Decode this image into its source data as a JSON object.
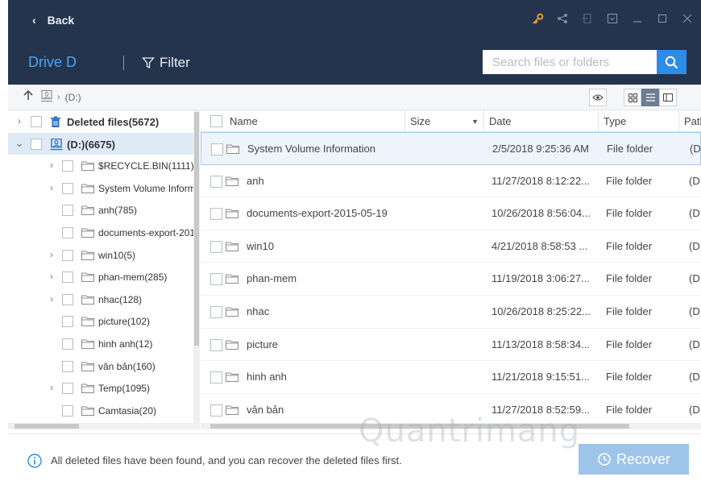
{
  "topbar": {
    "back_label": "Back",
    "drive_label": "Drive D",
    "filter_label": "Filter",
    "search_placeholder": "Search files or folders",
    "accent_color": "#2b8de8",
    "bar_color": "#24344d"
  },
  "pathbar": {
    "location": "(D:)"
  },
  "tree": {
    "items": [
      {
        "label": "Deleted files(5672)",
        "arrow": "›",
        "level": 0,
        "icon": "trash-icon"
      },
      {
        "label": "(D:)(6675)",
        "arrow": "⌄",
        "level": 0,
        "icon": "drive-icon",
        "selected": true
      },
      {
        "label": "$RECYCLE.BIN(1111)",
        "arrow": "›",
        "level": 1,
        "icon": "folder-icon"
      },
      {
        "label": "System Volume Inform",
        "arrow": "›",
        "level": 1,
        "icon": "folder-icon"
      },
      {
        "label": "anh(785)",
        "arrow": "",
        "level": 1,
        "icon": "folder-icon"
      },
      {
        "label": "documents-export-201",
        "arrow": "",
        "level": 1,
        "icon": "folder-icon"
      },
      {
        "label": "win10(5)",
        "arrow": "›",
        "level": 1,
        "icon": "folder-icon"
      },
      {
        "label": "phan-mem(285)",
        "arrow": "›",
        "level": 1,
        "icon": "folder-icon"
      },
      {
        "label": "nhac(128)",
        "arrow": "›",
        "level": 1,
        "icon": "folder-icon"
      },
      {
        "label": "picture(102)",
        "arrow": "",
        "level": 1,
        "icon": "folder-icon"
      },
      {
        "label": "hinh anh(12)",
        "arrow": "",
        "level": 1,
        "icon": "folder-icon"
      },
      {
        "label": "văn bản(160)",
        "arrow": "",
        "level": 1,
        "icon": "folder-icon"
      },
      {
        "label": "Temp(1095)",
        "arrow": "›",
        "level": 1,
        "icon": "folder-icon"
      },
      {
        "label": "Camtasia(20)",
        "arrow": "",
        "level": 1,
        "icon": "folder-icon"
      }
    ]
  },
  "list": {
    "columns": {
      "name": "Name",
      "size": "Size",
      "date": "Date",
      "type": "Type",
      "path": "Path"
    },
    "rows": [
      {
        "name": "System Volume Information",
        "date": "2/5/2018 9:25:36 AM",
        "type": "File folder",
        "path": "(D:",
        "selected": true
      },
      {
        "name": "anh",
        "date": "11/27/2018 8:12:22...",
        "type": "File folder",
        "path": "(D:"
      },
      {
        "name": "documents-export-2015-05-19",
        "date": "10/26/2018 8:56:04...",
        "type": "File folder",
        "path": "(D:"
      },
      {
        "name": "win10",
        "date": "4/21/2018 8:58:53 ...",
        "type": "File folder",
        "path": "(D:"
      },
      {
        "name": "phan-mem",
        "date": "11/19/2018 3:06:27...",
        "type": "File folder",
        "path": "(D:"
      },
      {
        "name": "nhac",
        "date": "10/26/2018 8:25:22...",
        "type": "File folder",
        "path": "(D:"
      },
      {
        "name": "picture",
        "date": "11/13/2018 8:58:34...",
        "type": "File folder",
        "path": "(D:"
      },
      {
        "name": "hinh anh",
        "date": "11/21/2018 9:15:51...",
        "type": "File folder",
        "path": "(D:"
      },
      {
        "name": "văn bản",
        "date": "11/27/2018 8:52:59...",
        "type": "File folder",
        "path": "(D:"
      }
    ]
  },
  "footer": {
    "message": "All deleted files have been found, and you can recover the deleted files first.",
    "recover_label": "Recover"
  },
  "watermark": "Quantrimang"
}
